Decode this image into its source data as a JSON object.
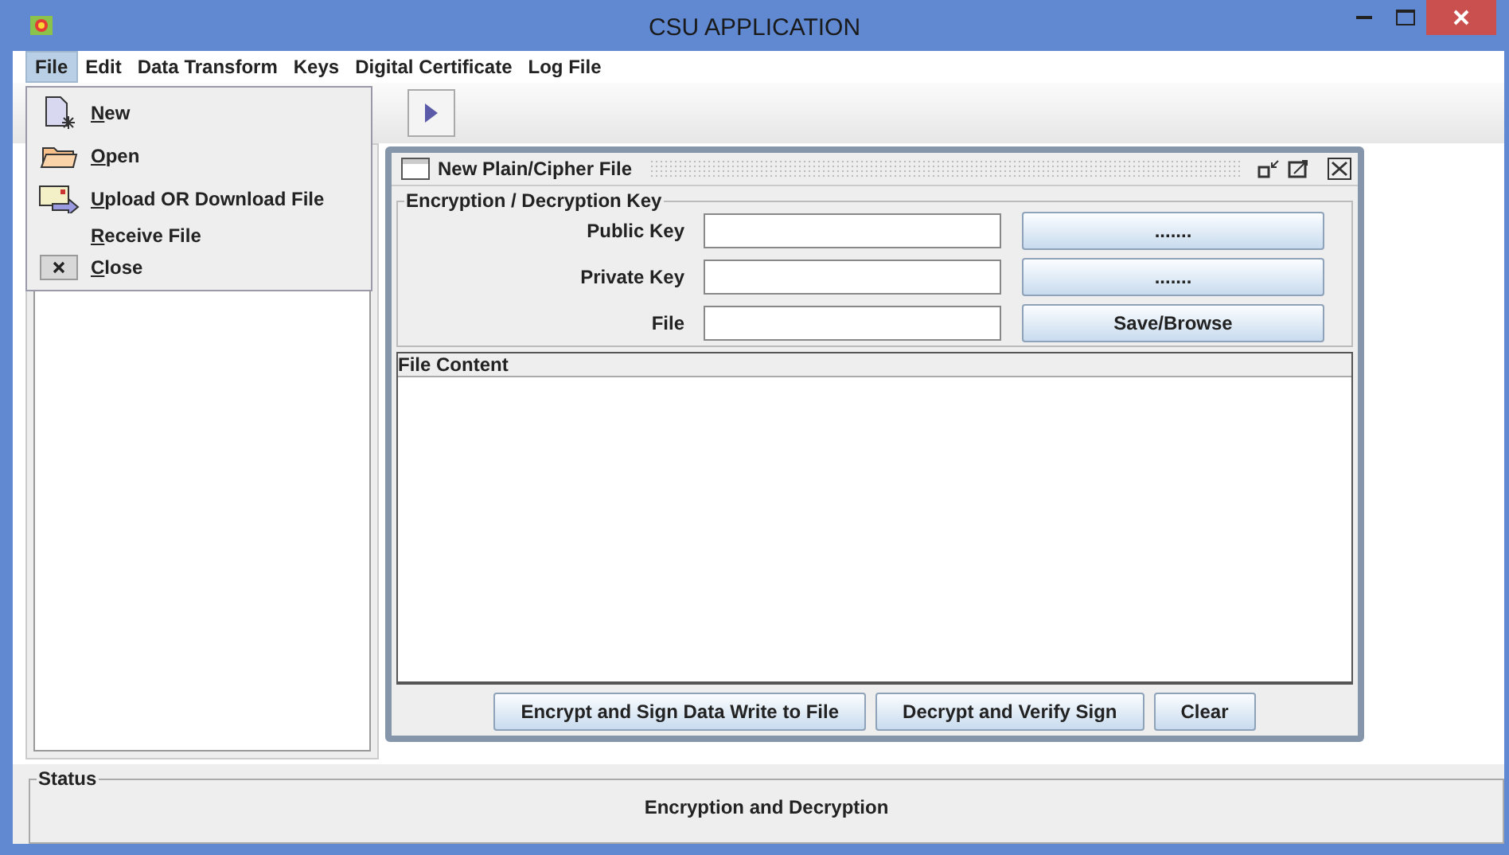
{
  "window": {
    "title": "CSU APPLICATION"
  },
  "menu": [
    {
      "label": "File",
      "selected": true
    },
    {
      "label": "Edit",
      "selected": false
    },
    {
      "label": "Data Transform",
      "selected": false
    },
    {
      "label": "Keys",
      "selected": false
    },
    {
      "label": "Digital Certificate",
      "selected": false
    },
    {
      "label": "Log File",
      "selected": false
    }
  ],
  "file_menu": [
    {
      "label": "New",
      "mnemonic": true
    },
    {
      "label": "Open",
      "mnemonic": true
    },
    {
      "label": "Upload OR Download File",
      "mnemonic": true
    },
    {
      "label": "Receive File",
      "mnemonic": true
    },
    {
      "label": "Close",
      "mnemonic": true
    }
  ],
  "internal_frame": {
    "title": "New Plain/Cipher File",
    "key_group": "Encryption / Decryption Key",
    "fields": [
      {
        "label": "Public Key",
        "button": "......."
      },
      {
        "label": "Private Key",
        "button": "......."
      },
      {
        "label": "File",
        "button": "Save/Browse"
      }
    ],
    "content_label": "File Content",
    "buttons": [
      "Encrypt and Sign Data Write to File",
      "Decrypt and Verify Sign",
      "Clear"
    ]
  },
  "status": {
    "title": "Status",
    "text": "Encryption and Decryption"
  }
}
